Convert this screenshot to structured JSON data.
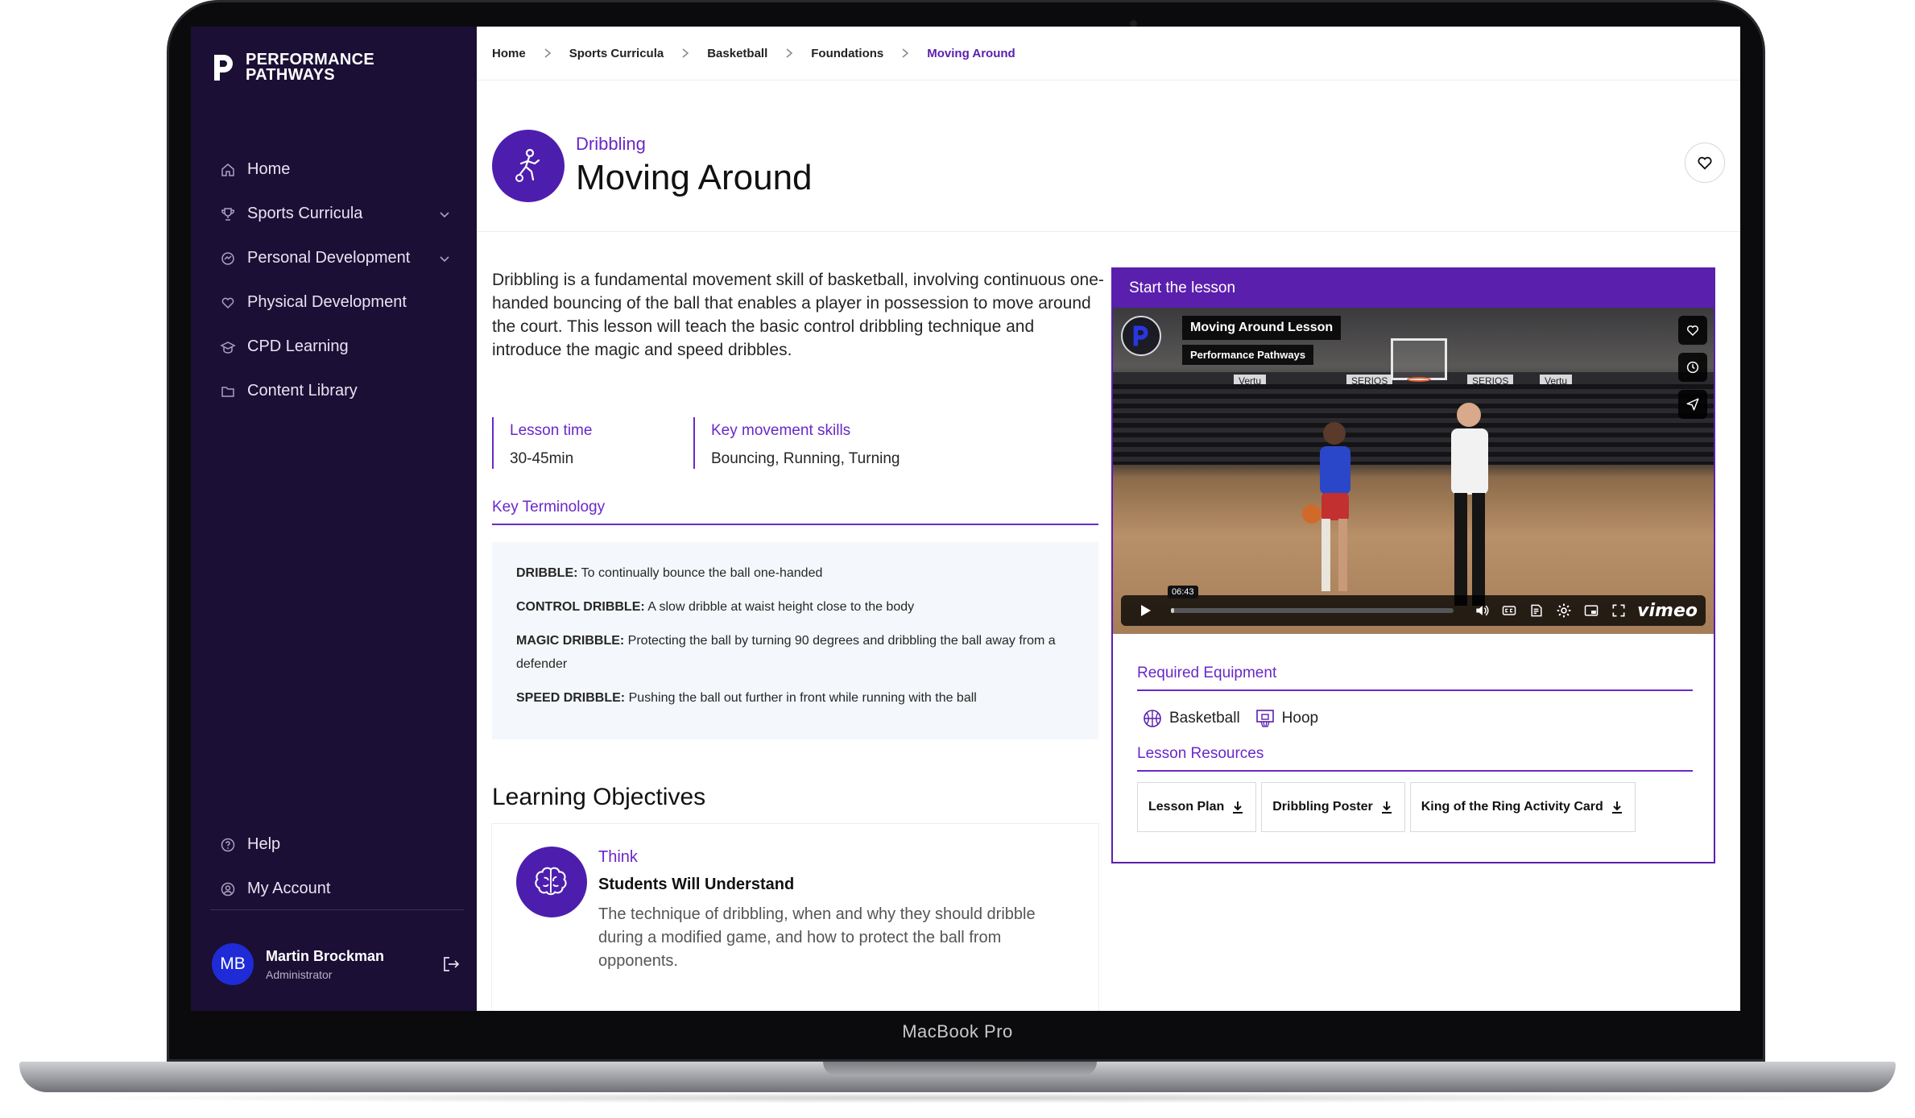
{
  "device": {
    "label": "MacBook Pro"
  },
  "brand": {
    "line1": "PERFORMANCE",
    "line2": "PATHWAYS",
    "accent": "#5b1fae",
    "sidebar_bg": "#1b0f35"
  },
  "sidebar": {
    "items": [
      {
        "label": "Home",
        "icon": "home-icon"
      },
      {
        "label": "Sports Curricula",
        "icon": "trophy-icon",
        "expandable": true
      },
      {
        "label": "Personal Development",
        "icon": "growth-icon",
        "expandable": true
      },
      {
        "label": "Physical Development",
        "icon": "heart-icon"
      },
      {
        "label": "CPD Learning",
        "icon": "graduation-cap-icon"
      },
      {
        "label": "Content Library",
        "icon": "folder-icon"
      }
    ],
    "bottom_items": [
      {
        "label": "Help",
        "icon": "help-icon"
      },
      {
        "label": "My Account",
        "icon": "account-icon"
      }
    ],
    "user": {
      "initials": "MB",
      "name": "Martin Brockman",
      "role": "Administrator"
    }
  },
  "breadcrumb": [
    "Home",
    "Sports Curricula",
    "Basketball",
    "Foundations",
    "Moving Around"
  ],
  "header": {
    "category": "Dribbling",
    "title": "Moving Around"
  },
  "intro": "Dribbling is a fundamental movement skill of basketball, involving continuous one-handed bouncing of the ball that enables a player in possession to move around the court. This lesson will teach the basic control dribbling technique and introduce the magic and speed dribbles.",
  "facts": {
    "lesson_time_label": "Lesson time",
    "lesson_time_value": "30-45min",
    "skills_label": "Key movement skills",
    "skills_value": "Bouncing, Running, Turning"
  },
  "terminology": {
    "title": "Key Terminology",
    "terms": [
      {
        "key": "DRIBBLE:",
        "text": "To continually bounce the ball one-handed"
      },
      {
        "key": "CONTROL DRIBBLE:",
        "text": "A slow dribble at waist height close to the body"
      },
      {
        "key": "MAGIC DRIBBLE:",
        "text": "Protecting the ball by turning 90 degrees and dribbling the ball away from a defender"
      },
      {
        "key": "SPEED DRIBBLE:",
        "text": "Pushing the ball out further in front while running with the ball"
      }
    ]
  },
  "objectives": {
    "title": "Learning Objectives",
    "card": {
      "kicker": "Think",
      "heading": "Students Will Understand",
      "text": "The technique of dribbling, when and why they should dribble during a modified game, and how to protect the ball from opponents."
    }
  },
  "lesson_panel": {
    "title": "Start the lesson",
    "video": {
      "title": "Moving Around Lesson",
      "byline": "Performance Pathways",
      "time": "06:43",
      "progress": 0.01,
      "ads": [
        "Vertu",
        "SERIOS",
        "SERIOS",
        "Vertu"
      ],
      "provider": "vimeo"
    },
    "equipment_title": "Required Equipment",
    "equipment": [
      {
        "label": "Basketball",
        "icon": "basketball-icon"
      },
      {
        "label": "Hoop",
        "icon": "hoop-icon"
      }
    ],
    "resources_title": "Lesson Resources",
    "resources": [
      "Lesson Plan",
      "Dribbling Poster",
      "King of the Ring Activity Card"
    ]
  }
}
